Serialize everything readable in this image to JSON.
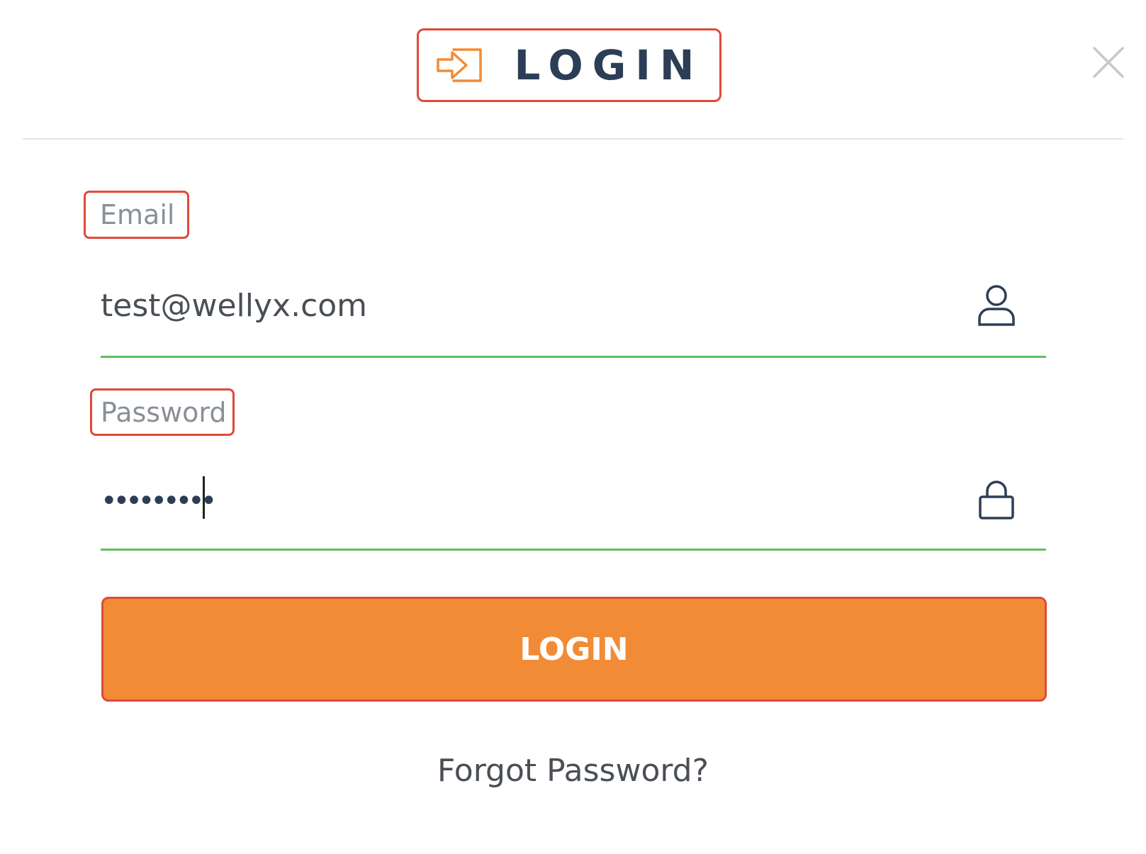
{
  "header": {
    "title": "LOGIN",
    "icon": "login-arrow-icon",
    "icon_color": "#f28b36",
    "title_color": "#2c3e55"
  },
  "close": {
    "icon": "close-icon"
  },
  "form": {
    "email": {
      "label": "Email",
      "value": "test@wellyx.com",
      "icon": "user-icon"
    },
    "password": {
      "label": "Password",
      "masked_value": "•••••••••",
      "icon": "lock-icon"
    },
    "active_underline_color": "#5cc15e"
  },
  "submit": {
    "label": "LOGIN",
    "color": "#f28b36"
  },
  "forgot_password": {
    "label": "Forgot Password?"
  },
  "highlight_color": "#e04a38"
}
